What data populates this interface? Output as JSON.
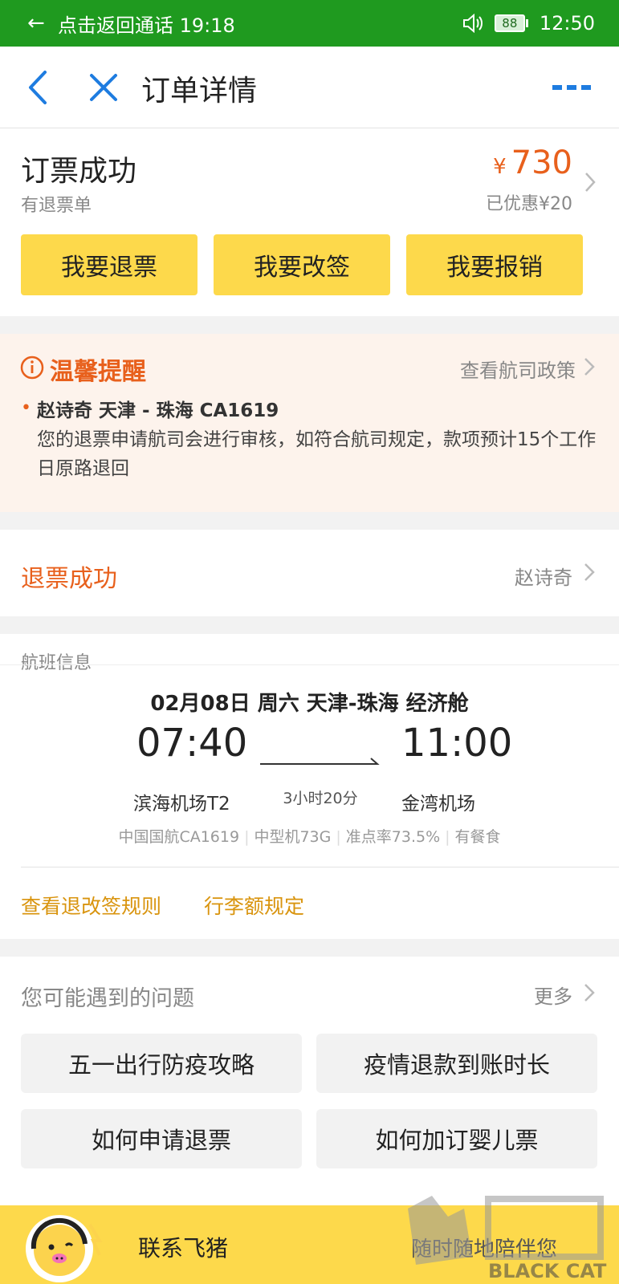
{
  "status_bar": {
    "call_text": "点击返回通话 19:18",
    "battery": "88",
    "time": "12:50"
  },
  "nav": {
    "title": "订单详情"
  },
  "order": {
    "status": "订票成功",
    "sub_status": "有退票单",
    "currency": "¥",
    "price": "730",
    "discount": "已优惠¥20",
    "actions": [
      "我要退票",
      "我要改签",
      "我要报销"
    ]
  },
  "notice": {
    "title": "温馨提醒",
    "policy_link": "查看航司政策",
    "passenger_line": "赵诗奇 天津 - 珠海 CA1619",
    "body": "您的退票申请航司会进行审核，如符合航司规定，款项预计15个工作日原路退回"
  },
  "refund": {
    "status": "退票成功",
    "passenger": "赵诗奇"
  },
  "flight": {
    "section_label": "航班信息",
    "date_line": "02月08日 周六 天津-珠海 经济舱",
    "dep_time": "07:40",
    "arr_time": "11:00",
    "duration": "3小时20分",
    "dep_airport": "滨海机场T2",
    "arr_airport": "金湾机场",
    "airline": "中国国航CA1619",
    "aircraft": "中型机73G",
    "on_time": "准点率73.5%",
    "meal": "有餐食",
    "links": [
      "查看退改签规则",
      "行李额规定"
    ]
  },
  "faq": {
    "title": "您可能遇到的问题",
    "more": "更多",
    "items": [
      "五一出行防疫攻略",
      "疫情退款到账时长",
      "如何申请退票",
      "如何加订婴儿票"
    ]
  },
  "bottom": {
    "contact": "联系飞猪",
    "slogan": "随时随地陪伴您"
  },
  "watermark": {
    "text": "BLACK CAT"
  },
  "colors": {
    "status_green": "#1f9a1f",
    "nav_blue": "#1e7ce0",
    "accent_orange": "#e8601c",
    "button_yellow": "#fdd94b",
    "link_gold": "#d9940e"
  }
}
